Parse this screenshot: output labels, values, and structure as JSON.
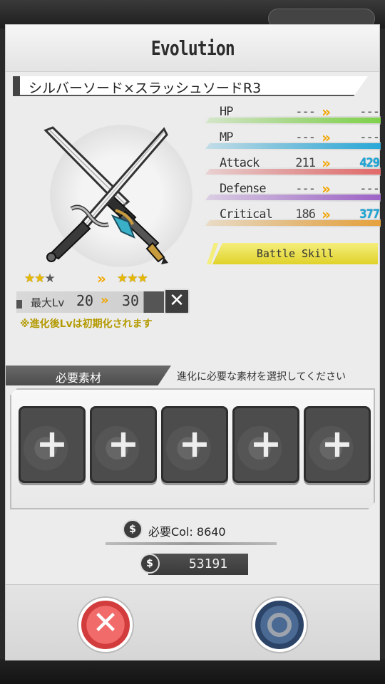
{
  "dialog": {
    "title": "Evolution"
  },
  "item": {
    "name": "シルバーソード×スラッシュソードR3"
  },
  "rarity": {
    "before_stars": 2,
    "before_max": 3,
    "after_stars": 3,
    "before_text": "★★",
    "before_empty": "★",
    "after_text": "★★★"
  },
  "level": {
    "label": "最大Lv",
    "before": "20",
    "after": "30",
    "note": "※進化後Lvは初期化されます"
  },
  "stats": [
    {
      "name": "HP",
      "before": "---",
      "after": "---",
      "color": "#7fd24a",
      "up": false
    },
    {
      "name": "MP",
      "before": "---",
      "after": "---",
      "color": "#2aa8d8",
      "up": false
    },
    {
      "name": "Attack",
      "before": "211",
      "after": "429",
      "color": "#e26a6a",
      "up": true
    },
    {
      "name": "Defense",
      "before": "---",
      "after": "---",
      "color": "#9e63c8",
      "up": false
    },
    {
      "name": "Critical",
      "before": "186",
      "after": "377",
      "color": "#e6a23c",
      "up": true
    }
  ],
  "battle_skill": {
    "label": "Battle Skill"
  },
  "materials": {
    "label": "必要素材",
    "hint": "進化に必要な素材を選択してください",
    "slot_symbol": "+",
    "slot_count": 5
  },
  "cost": {
    "label": "必要Col: 8640",
    "balance": "53191"
  },
  "arrow_symbol": "»",
  "colors": {
    "accent_gold": "#f2a500",
    "up_value": "#1ba7d8",
    "cancel": "#d23c3c",
    "confirm": "#2b4468",
    "skill": "#e0d22a"
  },
  "icons": {
    "cancel": "close-icon",
    "confirm": "circle-icon",
    "money": "money-bag-icon",
    "reset_level": "close-icon"
  }
}
